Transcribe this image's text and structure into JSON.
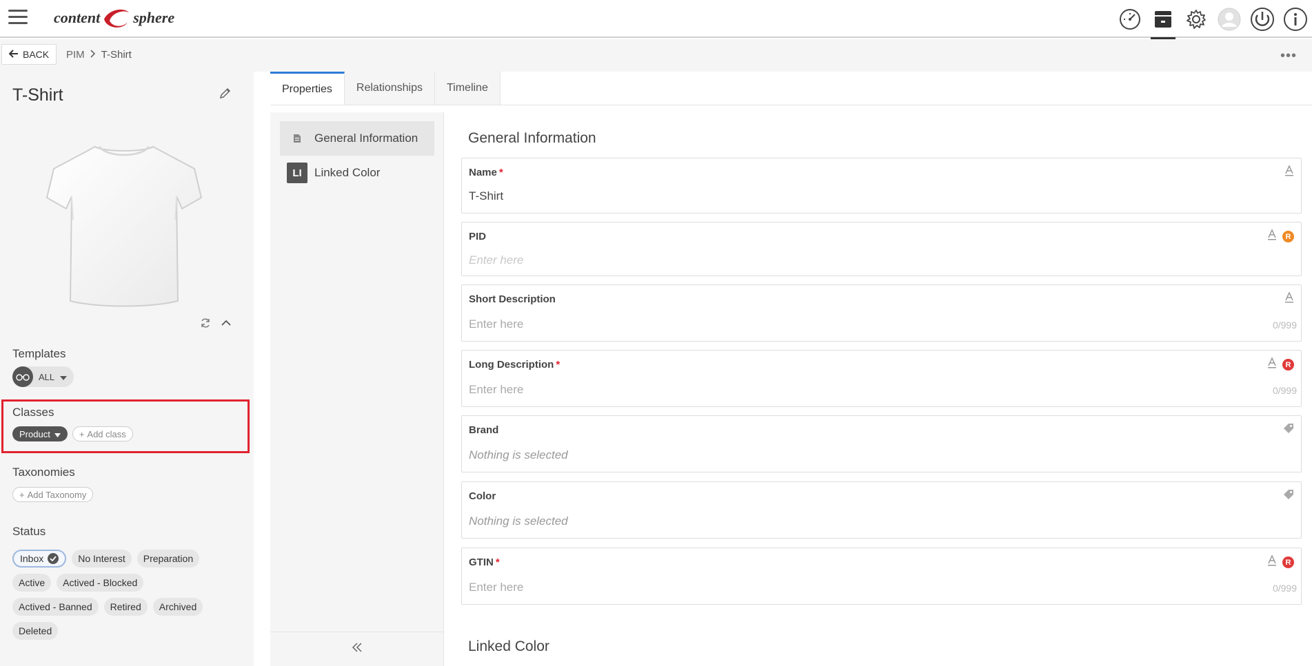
{
  "header": {
    "logo_left": "content",
    "logo_right": "sphere",
    "icons": [
      "dashboard-icon",
      "archive-box-icon",
      "gear-icon",
      "user-avatar-icon",
      "power-icon",
      "info-icon"
    ]
  },
  "breadcrumb": {
    "back_label": "BACK",
    "items": [
      "PIM",
      "T-Shirt"
    ]
  },
  "left_panel": {
    "title": "T-Shirt",
    "templates_label": "Templates",
    "template_value": "ALL",
    "classes_label": "Classes",
    "class_chip": "Product",
    "add_class": "Add class",
    "taxonomies_label": "Taxonomies",
    "add_taxonomy": "Add Taxonomy",
    "status_label": "Status",
    "statuses": [
      "Inbox",
      "No Interest",
      "Preparation",
      "Active",
      "Actived - Blocked",
      "Actived - Banned",
      "Retired",
      "Archived",
      "Deleted"
    ],
    "selected_status": "Inbox"
  },
  "tabs": [
    "Properties",
    "Relationships",
    "Timeline"
  ],
  "active_tab": "Properties",
  "inner_nav": {
    "items": [
      {
        "label": "General Information",
        "icon": "document-icon"
      },
      {
        "label": "Linked Color",
        "icon_text": "LI"
      }
    ]
  },
  "form": {
    "section_title": "General Information",
    "next_section_title": "Linked Color",
    "fields": {
      "name": {
        "label": "Name",
        "value": "T-Shirt"
      },
      "pid": {
        "label": "PID",
        "placeholder": "Enter here",
        "badge": "R"
      },
      "short_description": {
        "label": "Short Description",
        "placeholder": "Enter here",
        "counter": "0/999"
      },
      "long_description": {
        "label": "Long Description",
        "placeholder": "Enter here",
        "counter": "0/999",
        "badge": "R"
      },
      "brand": {
        "label": "Brand",
        "placeholder": "Nothing is selected"
      },
      "color": {
        "label": "Color",
        "placeholder": "Nothing is selected"
      },
      "gtin": {
        "label": "GTIN",
        "placeholder": "Enter here",
        "counter": "0/999",
        "badge": "R"
      }
    }
  },
  "colors": {
    "accent_blue": "#2f7bd6",
    "highlight_red": "#e0232e",
    "badge_orange": "#f08a24",
    "badge_red": "#e03a3a"
  }
}
